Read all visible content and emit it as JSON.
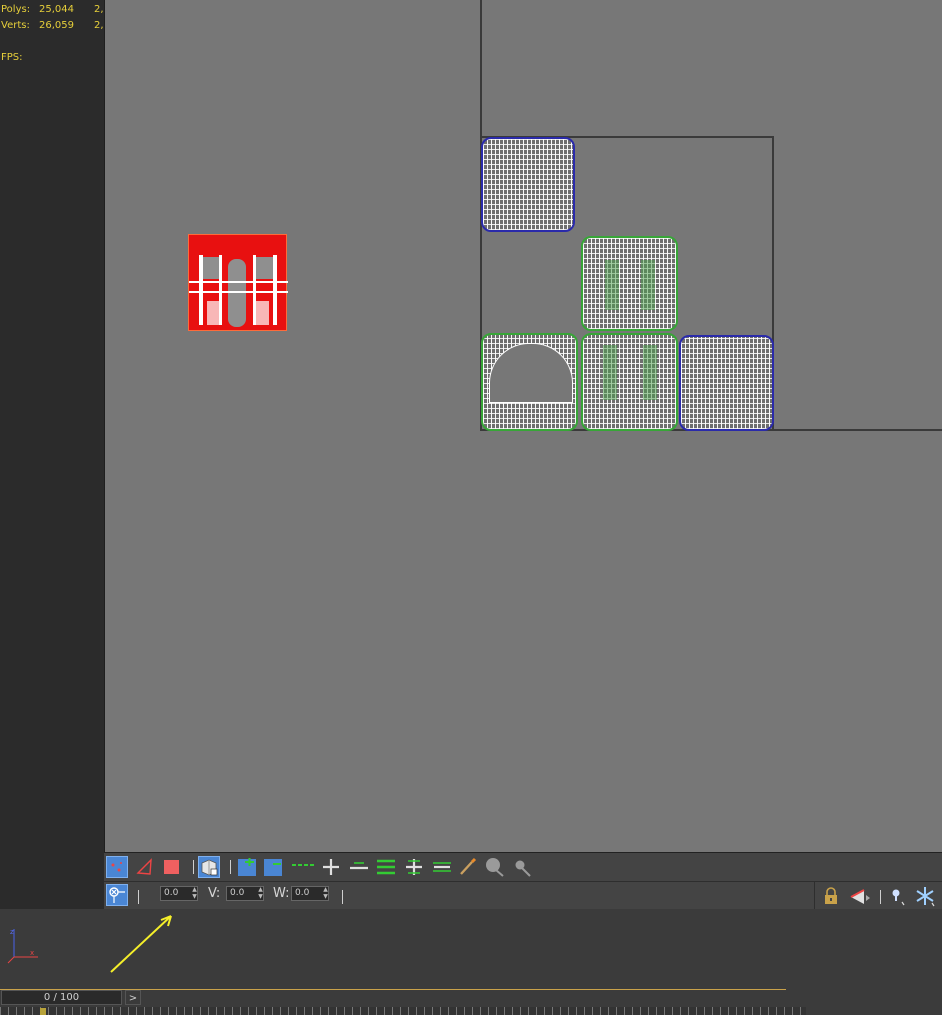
{
  "stats": {
    "polys_label": "Polys:",
    "polys_value": "25,044",
    "polys_value2": "2,",
    "verts_label": "Verts:",
    "verts_value": "26,059",
    "verts_value2": "2,",
    "fps_label": "FPS:"
  },
  "uv_editor": {
    "toolbar": {
      "u_value": "0.0",
      "v_label": "V:",
      "v_value": "0.0",
      "w_label": "W:",
      "w_value": "0.0"
    }
  },
  "timeline": {
    "position_text": "0 / 100",
    "next_label": ">"
  },
  "colors": {
    "selection_red": "#e81010",
    "uv_green_edge": "#37a637",
    "uv_blue_edge": "#2a2aaa",
    "active_button": "#4a86d4",
    "stats_text": "#e6cf3a",
    "annotation_arrow": "#f5ef2a"
  }
}
